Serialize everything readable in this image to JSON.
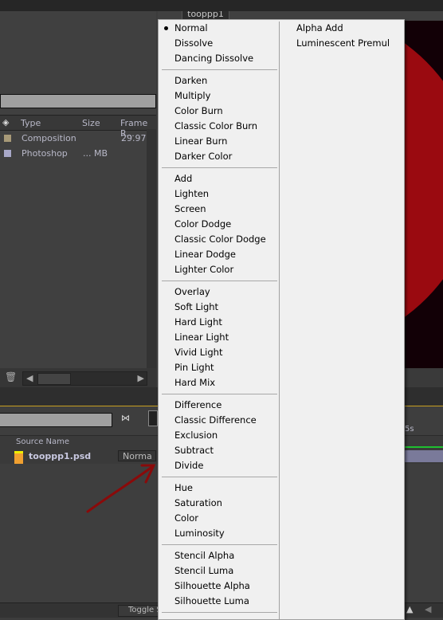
{
  "project_panel": {
    "columns": [
      "Type",
      "Size",
      "Frame R..."
    ],
    "rows": [
      {
        "type": "Composition",
        "size": "",
        "frame_rate": "29.97",
        "color": "#a89a78"
      },
      {
        "type": "Photoshop",
        "size": "... MB",
        "frame_rate": "",
        "color": "#a8a8c8"
      }
    ]
  },
  "viewer": {
    "tab": "tooppp1",
    "circle_color": "#9a0a10"
  },
  "timeline": {
    "column_header": "Source Name",
    "layer": {
      "name": "tooppp1.psd",
      "mode": "Norma"
    },
    "time_marker": "5s",
    "toggle_button": "Toggle S"
  },
  "blend_menu": {
    "selected": "Normal",
    "groups": [
      [
        "Normal",
        "Dissolve",
        "Dancing Dissolve"
      ],
      [
        "Darken",
        "Multiply",
        "Color Burn",
        "Classic Color Burn",
        "Linear Burn",
        "Darker Color"
      ],
      [
        "Add",
        "Lighten",
        "Screen",
        "Color Dodge",
        "Classic Color Dodge",
        "Linear Dodge",
        "Lighter Color"
      ],
      [
        "Overlay",
        "Soft Light",
        "Hard Light",
        "Linear Light",
        "Vivid Light",
        "Pin Light",
        "Hard Mix"
      ],
      [
        "Difference",
        "Classic Difference",
        "Exclusion",
        "Subtract",
        "Divide"
      ],
      [
        "Hue",
        "Saturation",
        "Color",
        "Luminosity"
      ],
      [
        "Stencil Alpha",
        "Stencil Luma",
        "Silhouette Alpha",
        "Silhouette Luma"
      ]
    ],
    "second_column": [
      "Alpha Add",
      "Luminescent Premul"
    ]
  }
}
